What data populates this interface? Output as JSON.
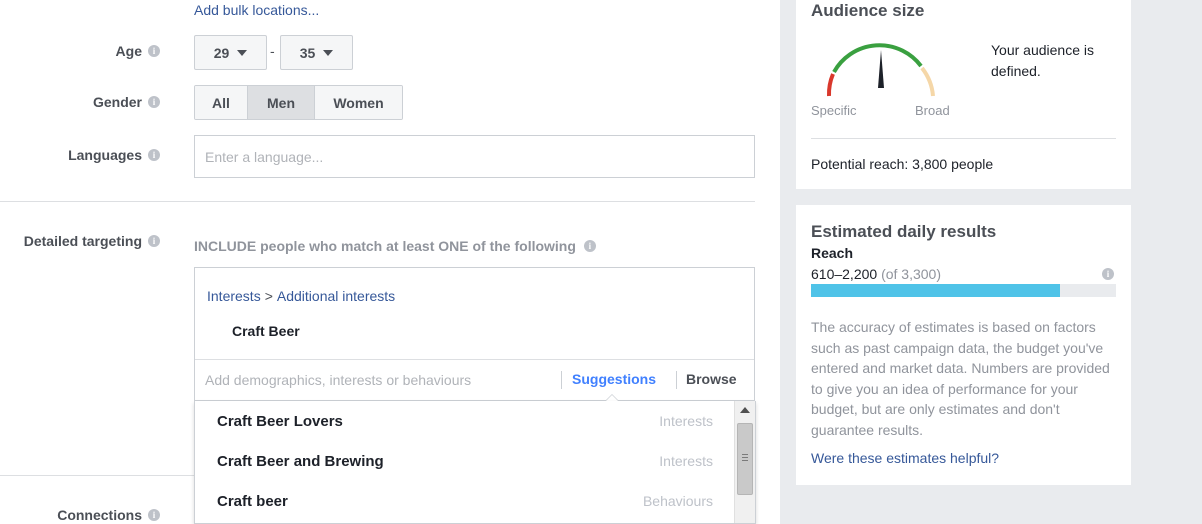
{
  "location": {
    "bulk_link": "Add bulk locations..."
  },
  "age": {
    "label": "Age",
    "min": "29",
    "separator": "-",
    "max": "35"
  },
  "gender": {
    "label": "Gender",
    "options": [
      "All",
      "Men",
      "Women"
    ],
    "selected": "Men"
  },
  "languages": {
    "label": "Languages",
    "placeholder": "Enter a language..."
  },
  "detailed_targeting": {
    "label": "Detailed targeting",
    "include_text": "INCLUDE people who match at least ONE of the following",
    "breadcrumb_root": "Interests",
    "breadcrumb_sep": ">",
    "breadcrumb_child": "Additional interests",
    "selected_item": "Craft Beer",
    "search_placeholder": "Add demographics, interests or behaviours",
    "suggestions_tab": "Suggestions",
    "browse_tab": "Browse",
    "suggestions": [
      {
        "name": "Craft Beer Lovers",
        "type": "Interests"
      },
      {
        "name": "Craft Beer and Brewing",
        "type": "Interests"
      },
      {
        "name": "Craft beer",
        "type": "Behaviours"
      }
    ]
  },
  "connections": {
    "label": "Connections"
  },
  "audience_size": {
    "title": "Audience size",
    "gauge_left": "Specific",
    "gauge_right": "Broad",
    "status": "Your audience is defined.",
    "potential_reach": "Potential reach: 3,800 people"
  },
  "daily_results": {
    "title": "Estimated daily results",
    "reach_label": "Reach",
    "reach_range": "610–2,200",
    "reach_total": "(of 3,300)",
    "reach_fill_fraction": 0.815,
    "bar_color": "#4fc3e8",
    "disclaimer": "The accuracy of estimates is based on factors such as past campaign data, the budget you've entered and market data. Numbers are provided to give you an idea of performance for your budget, but are only estimates and don't guarantee results.",
    "feedback_link": "Were these estimates helpful?"
  }
}
